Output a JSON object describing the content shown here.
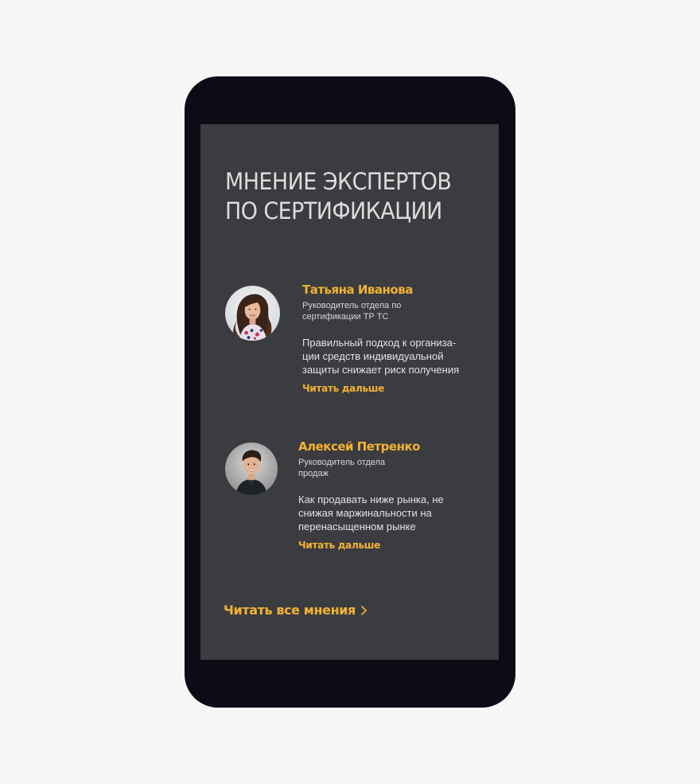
{
  "section": {
    "title_line1": "МНЕНИЕ ЭКСПЕРТОВ",
    "title_line2": "ПО СЕРТИФИКАЦИИ"
  },
  "experts": [
    {
      "name": "Татьяна Иванова",
      "role_line1": "Руководитель отдела по",
      "role_line2": "сертификации ТР ТС",
      "quote_line1": "Правильный подход к организа-",
      "quote_line2": "ции средств индивидуальной",
      "quote_line3": "защиты снижает риск получения",
      "link": "Читать дальше",
      "avatar_icon": "avatar-woman-photo"
    },
    {
      "name": "Алексей Петренко",
      "role_line1": "Руководитель отдела",
      "role_line2": "продаж",
      "quote_line1": "Как продавать ниже рынка, не",
      "quote_line2": "снижая маржинальности на",
      "quote_line3": "перенасыщенном рынке",
      "link": "Читать дальше",
      "avatar_icon": "avatar-man-photo"
    }
  ],
  "footer_link": {
    "label": "Читать все мнения",
    "icon": "chevron-right-icon"
  },
  "colors": {
    "accent": "#f2b233",
    "panel": "#3b3c40",
    "device": "#0b0c15",
    "page": "#f6f6f6"
  }
}
